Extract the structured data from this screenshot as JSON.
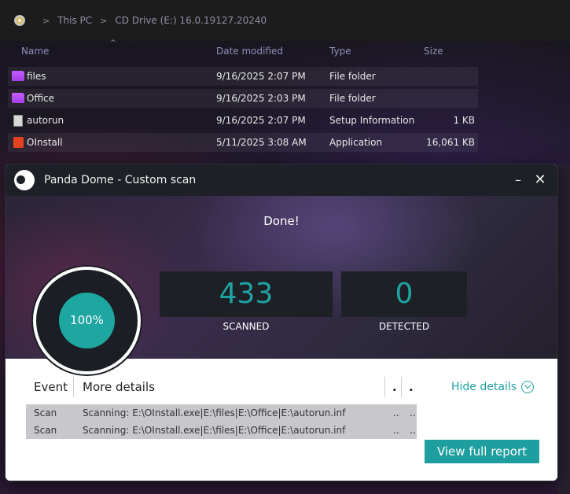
{
  "explorer": {
    "breadcrumbs": [
      "This PC",
      "CD Drive (E:) 16.0.19127.20240"
    ],
    "columns": {
      "name": "Name",
      "date": "Date modified",
      "type": "Type",
      "size": "Size"
    },
    "files": [
      {
        "name": "files",
        "date": "9/16/2025 2:07 PM",
        "type": "File folder",
        "size": "",
        "icon": "folder-icon"
      },
      {
        "name": "Office",
        "date": "9/16/2025 2:03 PM",
        "type": "File folder",
        "size": "",
        "icon": "folder-icon"
      },
      {
        "name": "autorun",
        "date": "9/16/2025 2:07 PM",
        "type": "Setup Information",
        "size": "1 KB",
        "icon": "setup-file-icon"
      },
      {
        "name": "OInstall",
        "date": "5/11/2025 3:08 AM",
        "type": "Application",
        "size": "16,061 KB",
        "icon": "office-app-icon"
      }
    ]
  },
  "panda": {
    "title": "Panda Dome - Custom scan",
    "status": "Done!",
    "progress_label": "100%",
    "progress_fraction": 1.0,
    "scanned_value": "433",
    "scanned_label": "SCANNED",
    "detected_value": "0",
    "detected_label": "DETECTED",
    "table": {
      "headers": [
        "Event",
        "More details",
        ".",
        "."
      ],
      "rows": [
        {
          "event": "Scan",
          "details": "Scanning: E:\\OInstall.exe|E:\\files|E:\\Office|E:\\autorun.inf",
          "c3": "..",
          "c4": ".."
        },
        {
          "event": "Scan",
          "details": "Scanning: E:\\OInstall.exe|E:\\files|E:\\Office|E:\\autorun.inf",
          "c3": "..",
          "c4": ".."
        }
      ]
    },
    "hide_details_label": "Hide details",
    "report_button": "View full report",
    "accent_color": "#1ea0a0"
  }
}
